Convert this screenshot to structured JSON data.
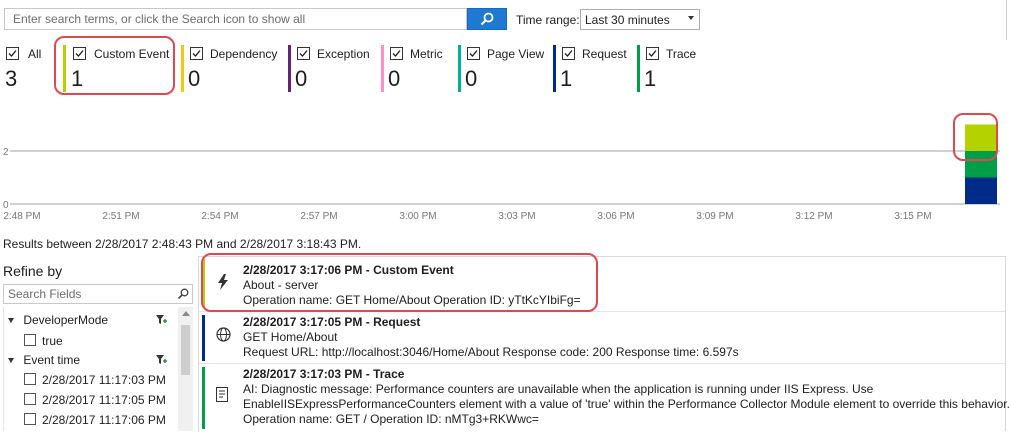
{
  "search": {
    "placeholder": "Enter search terms, or click the Search icon to show all",
    "time_range_label": "Time range:",
    "time_range_value": "Last 30 minutes"
  },
  "type_filters": [
    {
      "label": "All",
      "count": "3",
      "color": ""
    },
    {
      "label": "Custom Event",
      "count": "1",
      "color": "#b4d200"
    },
    {
      "label": "Dependency",
      "count": "0",
      "color": "#f2c811"
    },
    {
      "label": "Exception",
      "count": "0",
      "color": "#68217a"
    },
    {
      "label": "Metric",
      "count": "0",
      "color": "#ff8ec4"
    },
    {
      "label": "Page View",
      "count": "0",
      "color": "#00b294"
    },
    {
      "label": "Request",
      "count": "1",
      "color": "#002b88"
    },
    {
      "label": "Trace",
      "count": "1",
      "color": "#009e49"
    }
  ],
  "chart": {
    "y_ticks": [
      "2",
      "0"
    ],
    "x_ticks": [
      "2:48 PM",
      "2:51 PM",
      "2:54 PM",
      "2:57 PM",
      "3:00 PM",
      "3:03 PM",
      "3:06 PM",
      "3:09 PM",
      "3:12 PM",
      "3:15 PM"
    ]
  },
  "chart_data": {
    "type": "bar",
    "stacked": true,
    "categories": [
      "3:17 PM"
    ],
    "series": [
      {
        "name": "Request",
        "values": [
          1
        ],
        "color": "#002b88"
      },
      {
        "name": "Trace",
        "values": [
          1
        ],
        "color": "#009e49"
      },
      {
        "name": "Custom Event",
        "values": [
          1
        ],
        "color": "#b4d200"
      }
    ],
    "ylim": [
      0,
      3
    ],
    "grid": true
  },
  "results_summary": "Results between 2/28/2017 2:48:43 PM and 2/28/2017 3:18:43 PM.",
  "refine": {
    "title": "Refine by",
    "search_placeholder": "Search Fields",
    "groups": [
      {
        "name": "DeveloperMode",
        "values": [
          "true"
        ]
      },
      {
        "name": "Event time",
        "values": [
          "2/28/2017 11:17:03 PM",
          "2/28/2017 11:17:05 PM",
          "2/28/2017 11:17:06 PM"
        ]
      }
    ]
  },
  "results": [
    {
      "title": "2/28/2017 3:17:06 PM - Custom Event",
      "line2": "About - server",
      "line3": "Operation name: GET Home/About Operation ID: yTtKcYIbiFg=",
      "icon": "lightning-icon",
      "color": "#b4d200"
    },
    {
      "title": "2/28/2017 3:17:05 PM - Request",
      "line2": "GET Home/About",
      "line3": "Request URL: http://localhost:3046/Home/About Response code: 200 Response time: 6.597s",
      "icon": "globe-icon",
      "color": "#002b88"
    },
    {
      "title": "2/28/2017 3:17:03 PM - Trace",
      "line2": "AI: Diagnostic message: Performance counters are unavailable when the application is running under IIS Express. Use",
      "line3": "EnableIISExpressPerformanceCounters element with a value of 'true' within the Performance Collector Module element to override this behavior.",
      "line4": "Operation name: GET / Operation ID: nMTg3+RKWwc=",
      "icon": "document-icon",
      "color": "#009e49"
    }
  ]
}
